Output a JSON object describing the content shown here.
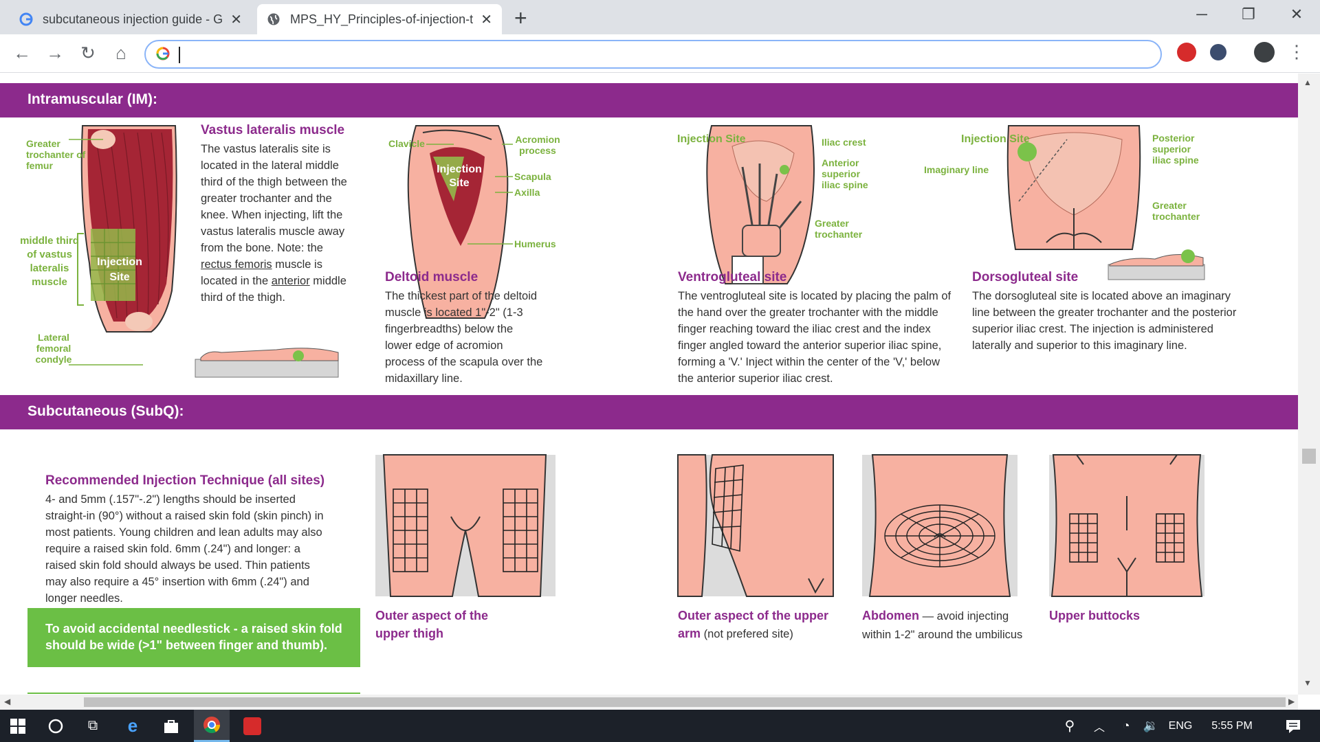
{
  "browser": {
    "tabs": [
      {
        "title": "subcutaneous injection guide - G",
        "close": "✕"
      },
      {
        "title": "MPS_HY_Principles-of-injection-t",
        "close": "✕"
      }
    ],
    "new_tab": "+",
    "address_value": ""
  },
  "im": {
    "band_title": "Intramuscular (IM):",
    "vastus": {
      "label_greater": "Greater trochanter of femur",
      "label_middle": "middle third of vastus lateralis muscle",
      "label_site": "Injection Site",
      "label_condyle": "Lateral femoral condyle",
      "heading": "Vastus lateralis muscle",
      "text_1": "The vastus lateralis site is located in the lateral middle third of the thigh between the greater trochanter and the knee. When injecting, lift the vastus lateralis muscle away from the bone. Note: the ",
      "text_link1": "rectus femoris",
      "text_2": " muscle is located in the ",
      "text_link2": "anterior",
      "text_3": " middle third of the thigh."
    },
    "deltoid": {
      "label_clavicle": "Clavicle",
      "label_acromion": "Acromion process",
      "label_site": "Injection Site",
      "label_scapula": "Scapula",
      "label_axilla": "Axilla",
      "label_humerus": "Humerus",
      "heading": "Deltoid muscle",
      "text": "The thickest part of the deltoid muscle is located 1\"-2\" (1-3 fingerbreadths) below the lower edge of acromion process of the scapula over the midaxillary line."
    },
    "ventro": {
      "label_site": "Injection Site",
      "label_iliac": "Iliac crest",
      "label_anterior": "Anterior superior iliac spine",
      "label_greater": "Greater trochanter",
      "heading": "Ventrogluteal site",
      "text": "The ventrogluteal site is located by placing the palm of the hand over the greater trochanter with the middle finger reaching toward the iliac crest and the index finger angled toward the anterior superior iliac spine, forming a 'V.' Inject within the center of the 'V,' below the anterior superior iliac crest."
    },
    "dorso": {
      "label_site": "Injection Site",
      "label_imaginary": "Imaginary line",
      "label_posterior": "Posterior superior iliac spine",
      "label_greater": "Greater trochanter",
      "heading": "Dorsogluteal site",
      "text": "The dorsogluteal site is located above an imaginary line between the greater trochanter and the posterior superior iliac crest. The injection is administered laterally and superior to this imaginary line."
    }
  },
  "subq": {
    "band_title": "Subcutaneous (SubQ):",
    "technique_heading": "Recommended Injection Technique (all sites)",
    "technique_text": "4- and 5mm (.157\"-.2\") lengths should be inserted straight-in (90°) without a raised skin fold (skin pinch) in most patients. Young children and lean adults may also require a raised skin fold. 6mm (.24\") and longer: a raised skin fold should always be used. Thin patients may also require a 45° insertion with 6mm (.24\") and longer needles.",
    "tip": "To avoid accidental needlestick - a raised skin fold should be wide (>1\" between finger and thumb).",
    "thigh_caption": "Outer aspect of the upper thigh",
    "arm_caption_bold": "Outer aspect of the upper arm",
    "arm_caption_rest": " (not prefered site)",
    "abdomen_caption_bold": "Abdomen",
    "abdomen_caption_rest": " — avoid injecting within 1-2\" around the umbilicus",
    "buttocks_caption": "Upper buttocks"
  },
  "taskbar": {
    "language": "ENG",
    "time": "5:55 PM"
  },
  "colors": {
    "band": "#8c2a8c",
    "accent_green": "#7bb23e",
    "skin": "#f7b1a1",
    "muscle": "#a52535",
    "tip_bg": "#6bbf45"
  }
}
